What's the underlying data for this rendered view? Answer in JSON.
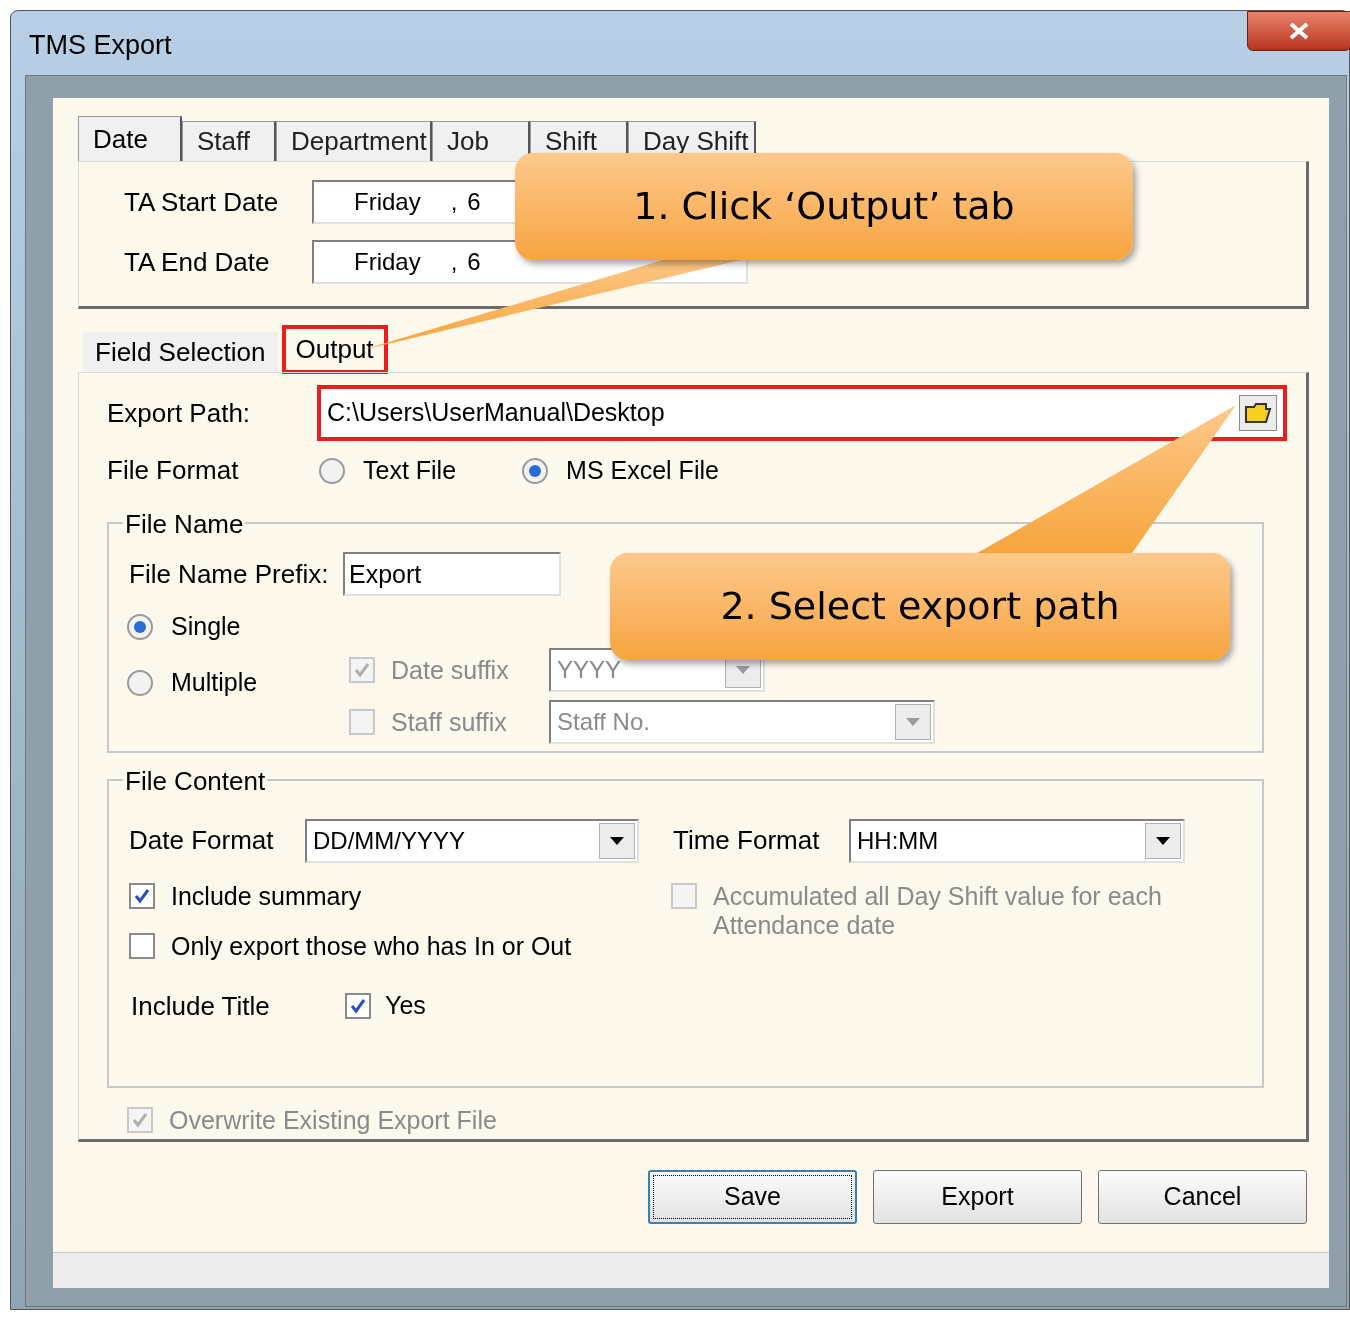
{
  "window": {
    "title": "TMS Export"
  },
  "filter_tabs": [
    {
      "label": "Date",
      "selected": true
    },
    {
      "label": "Staff",
      "selected": false
    },
    {
      "label": "Department",
      "selected": false
    },
    {
      "label": "Job",
      "selected": false
    },
    {
      "label": "Shift",
      "selected": false
    },
    {
      "label": "Day Shift",
      "selected": false
    }
  ],
  "date_range": [
    {
      "label": "TA Start Date",
      "weekday": "Friday",
      "separator": ",",
      "day": "6"
    },
    {
      "label": "TA End Date",
      "weekday": "Friday",
      "separator": ",",
      "day": "6"
    }
  ],
  "section_tabs": [
    {
      "label": "Field Selection",
      "selected": false,
      "highlighted": false
    },
    {
      "label": "Output",
      "selected": true,
      "highlighted": true
    }
  ],
  "export_path": {
    "label": "Export Path:",
    "value": "C:\\Users\\UserManual\\Desktop",
    "highlighted": true
  },
  "file_format": {
    "label": "File Format",
    "options": [
      {
        "label": "Text File",
        "selected": false
      },
      {
        "label": "MS Excel File",
        "selected": true
      }
    ]
  },
  "file_name": {
    "title": "File Name",
    "prefix_label": "File Name Prefix:",
    "prefix_value": "Export",
    "modes": [
      {
        "label": "Single",
        "selected": true
      },
      {
        "label": "Multiple",
        "selected": false
      }
    ],
    "suffixes": [
      {
        "label": "Date suffix",
        "checked": true,
        "disabled": true,
        "value": "YYYY"
      },
      {
        "label": "Staff suffix",
        "checked": false,
        "disabled": true,
        "value": "Staff No."
      }
    ]
  },
  "file_content": {
    "title": "File Content",
    "date_format": {
      "label": "Date Format",
      "value": "DD/MM/YYYY"
    },
    "time_format": {
      "label": "Time Format",
      "value": "HH:MM"
    },
    "options": [
      {
        "label": "Include summary",
        "checked": true,
        "disabled": false
      },
      {
        "label": "Only export those who has In or Out",
        "checked": false,
        "disabled": false
      },
      {
        "label": "Accumulated all Day Shift value for each Attendance date",
        "checked": false,
        "disabled": true
      }
    ],
    "include_title": {
      "label": "Include Title",
      "option": "Yes",
      "checked": true
    }
  },
  "overwrite": {
    "label": "Overwrite Existing Export File",
    "checked": true,
    "disabled": true
  },
  "buttons": [
    {
      "label": "Save",
      "focused": true
    },
    {
      "label": "Export",
      "focused": false
    },
    {
      "label": "Cancel",
      "focused": false
    }
  ],
  "callouts": [
    {
      "text": "1. Click ‘Output’ tab"
    },
    {
      "text": "2. Select export path"
    }
  ]
}
